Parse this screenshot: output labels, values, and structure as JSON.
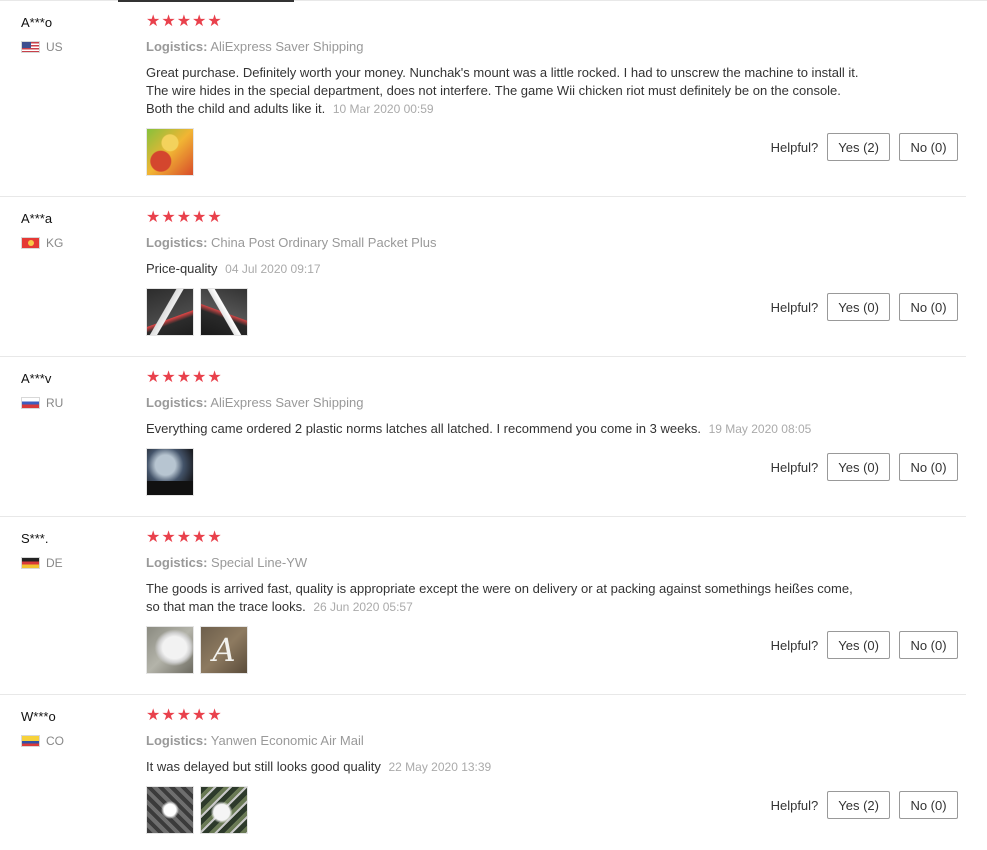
{
  "helpful_label": "Helpful?",
  "star_color": "#e9414c",
  "logistics_label": "Logistics:",
  "reviews": [
    {
      "user": "A***o",
      "country": "US",
      "flag": "us-flag",
      "rating": 5,
      "logistics": "AliExpress Saver Shipping",
      "text": "Great purchase. Definitely worth your money. Nunchak's mount was a little rocked. I had to unscrew the machine to install it. The wire hides in the special department, does not interfere. The game Wii chicken riot must definitely be on the console. Both the child and adults like it.",
      "date": "10 Mar 2020 00:59",
      "photos": [
        "game-cover-photo"
      ],
      "yes": "Yes (2)",
      "no": "No (0)"
    },
    {
      "user": "A***a",
      "country": "KG",
      "flag": "kg-flag",
      "rating": 5,
      "logistics": "China Post Ordinary Small Packet Plus",
      "text": "Price-quality",
      "date": "04 Jul 2020 09:17",
      "photos": [
        "steering-grip-photo",
        "steering-grip-photo"
      ],
      "yes": "Yes (0)",
      "no": "No (0)"
    },
    {
      "user": "A***v",
      "country": "RU",
      "flag": "ru-flag",
      "rating": 5,
      "logistics": "AliExpress Saver Shipping",
      "text": "Everything came ordered 2 plastic norms latches all latched. I recommend you come in 3 weeks.",
      "date": "19 May 2020 08:05",
      "photos": [
        "tv-screen-photo"
      ],
      "yes": "Yes (0)",
      "no": "No (0)"
    },
    {
      "user": "S***.",
      "country": "DE",
      "flag": "de-flag",
      "rating": 5,
      "logistics": "Special Line-YW",
      "text": "The goods is arrived fast, quality is appropriate except the were on delivery or at packing against somethings heißes come, so that man the trace looks.",
      "date": "26 Jun 2020 05:57",
      "photos": [
        "white-grip-photo",
        "letter-shape-photo"
      ],
      "photo_glyph": "A",
      "yes": "Yes (0)",
      "no": "No (0)"
    },
    {
      "user": "W***o",
      "country": "CO",
      "flag": "co-flag",
      "rating": 5,
      "logistics": "Yanwen Economic Air Mail",
      "text": "It was delayed but still looks good quality",
      "date": "22 May 2020 13:39",
      "photos": [
        "remote-photo",
        "controller-photo"
      ],
      "yes": "Yes (2)",
      "no": "No (0)"
    }
  ]
}
